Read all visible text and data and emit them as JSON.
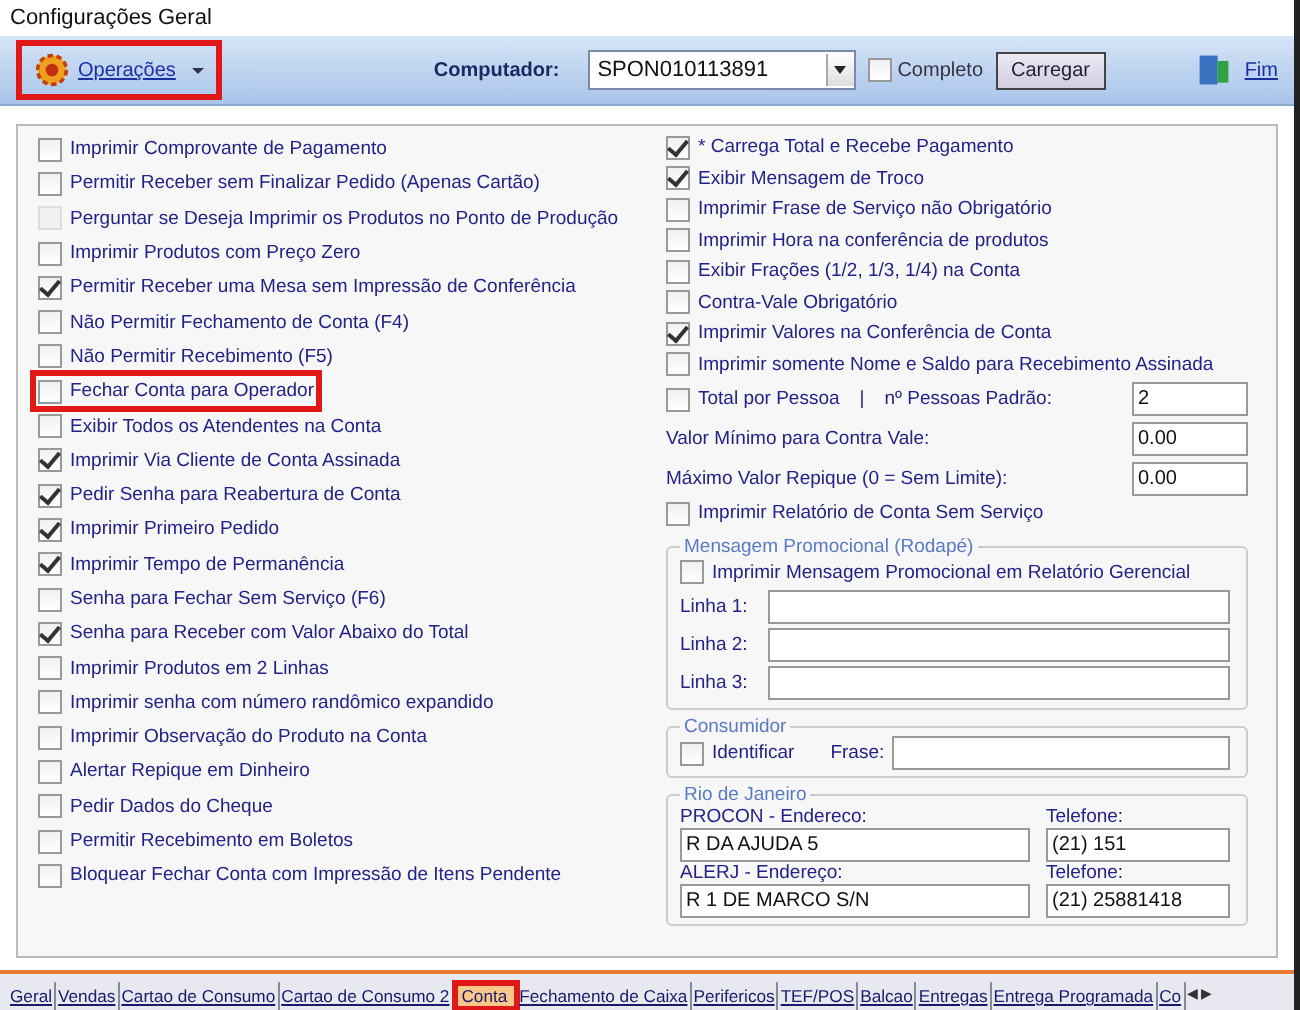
{
  "window": {
    "title": "Configurações Geral"
  },
  "toolbar": {
    "menu": {
      "label": "Operações",
      "highlighted": true
    },
    "computer_label": "Computador:",
    "computer_value": "SPON010113891",
    "complete": {
      "label": "Completo",
      "checked": false
    },
    "load_button": "Carregar",
    "exit_button": "Fim"
  },
  "left_options": [
    {
      "label": "Imprimir Comprovante de Pagamento",
      "checked": false,
      "disabled": false,
      "highlighted": false
    },
    {
      "label": "Permitir Receber sem Finalizar Pedido (Apenas Cartão)",
      "checked": false,
      "disabled": false,
      "highlighted": false
    },
    {
      "label": "Perguntar se Deseja Imprimir os Produtos no Ponto de Produção",
      "checked": false,
      "disabled": true,
      "highlighted": false
    },
    {
      "label": "Imprimir Produtos com Preço Zero",
      "checked": false,
      "disabled": false,
      "highlighted": false
    },
    {
      "label": "Permitir Receber uma Mesa sem Impressão de Conferência",
      "checked": true,
      "disabled": false,
      "highlighted": false
    },
    {
      "label": "Não Permitir Fechamento de Conta (F4)",
      "checked": false,
      "disabled": false,
      "highlighted": false
    },
    {
      "label": "Não Permitir Recebimento (F5)",
      "checked": false,
      "disabled": false,
      "highlighted": false
    },
    {
      "label": "Fechar Conta para Operador",
      "checked": false,
      "disabled": false,
      "highlighted": true
    },
    {
      "label": "Exibir Todos os Atendentes na Conta",
      "checked": false,
      "disabled": false,
      "highlighted": false
    },
    {
      "label": "Imprimir Via Cliente de Conta Assinada",
      "checked": true,
      "disabled": false,
      "highlighted": false
    },
    {
      "label": "Pedir Senha para Reabertura de Conta",
      "checked": true,
      "disabled": false,
      "highlighted": false
    },
    {
      "label": "Imprimir Primeiro Pedido",
      "checked": true,
      "disabled": false,
      "highlighted": false
    },
    {
      "label": "Imprimir Tempo de Permanência",
      "checked": true,
      "disabled": false,
      "highlighted": false
    },
    {
      "label": "Senha para Fechar Sem Serviço (F6)",
      "checked": false,
      "disabled": false,
      "highlighted": false
    },
    {
      "label": "Senha para Receber com Valor Abaixo do Total",
      "checked": true,
      "disabled": false,
      "highlighted": false
    },
    {
      "label": "Imprimir Produtos em 2 Linhas",
      "checked": false,
      "disabled": false,
      "highlighted": false
    },
    {
      "label": "Imprimir senha com número randômico expandido",
      "checked": false,
      "disabled": false,
      "highlighted": false
    },
    {
      "label": "Imprimir Observação do Produto na Conta",
      "checked": false,
      "disabled": false,
      "highlighted": false
    },
    {
      "label": "Alertar Repique em Dinheiro",
      "checked": false,
      "disabled": false,
      "highlighted": false
    },
    {
      "label": "Pedir Dados do Cheque",
      "checked": false,
      "disabled": false,
      "highlighted": false
    },
    {
      "label": "Permitir Recebimento em Boletos",
      "checked": false,
      "disabled": false,
      "highlighted": false
    },
    {
      "label": "Bloquear Fechar Conta com Impressão de Itens Pendente",
      "checked": false,
      "disabled": false,
      "highlighted": false
    }
  ],
  "right_options": [
    {
      "label": "* Carrega Total e Recebe Pagamento",
      "checked": true
    },
    {
      "label": "Exibir Mensagem de Troco",
      "checked": true
    },
    {
      "label": "Imprimir Frase de Serviço não Obrigatório",
      "checked": false
    },
    {
      "label": "Imprimir Hora na conferência de produtos",
      "checked": false
    },
    {
      "label": "Exibir Frações (1/2, 1/3, 1/4) na Conta",
      "checked": false
    },
    {
      "label": "Contra-Vale Obrigatório",
      "checked": false
    },
    {
      "label": "Imprimir Valores na Conferência de Conta",
      "checked": true
    },
    {
      "label": "Imprimir somente Nome e Saldo para Recebimento Assinada",
      "checked": false
    }
  ],
  "per_person": {
    "label": "Total por Pessoa",
    "checked": false,
    "separator": "|",
    "people_label": "nº Pessoas Padrão:",
    "people_value": "2"
  },
  "value_fields": [
    {
      "label": "Valor Mínimo para Contra Vale:",
      "value": "0.00"
    },
    {
      "label": "Máximo Valor Repique (0 = Sem Limite):",
      "value": "0.00"
    }
  ],
  "report_option": {
    "label": "Imprimir Relatório de Conta Sem Serviço",
    "checked": false
  },
  "promo": {
    "title": "Mensagem Promocional (Rodapé)",
    "option": {
      "label": "Imprimir Mensagem Promocional em Relatório Gerencial",
      "checked": false
    },
    "lines": [
      {
        "label": "Linha 1:"
      },
      {
        "label": "Linha 2:"
      },
      {
        "label": "Linha 3:"
      }
    ]
  },
  "consumer": {
    "title": "Consumidor",
    "identify": {
      "label": "Identificar",
      "checked": false
    },
    "phrase_label": "Frase:"
  },
  "rio": {
    "title": "Rio de Janeiro",
    "rows": [
      {
        "address_label": "PROCON - Endereco:",
        "address": "R DA AJUDA 5",
        "phone_label": "Telefone:",
        "phone": "(21) 151"
      },
      {
        "address_label": "ALERJ - Endereço:",
        "address": "R 1 DE MARCO S/N",
        "phone_label": "Telefone:",
        "phone": "(21) 25881418"
      }
    ]
  },
  "tabs": [
    {
      "label": "Geral",
      "selected": false,
      "highlighted": false
    },
    {
      "label": "Vendas",
      "selected": false,
      "highlighted": false
    },
    {
      "label": "Cartao de Consumo",
      "selected": false,
      "highlighted": false
    },
    {
      "label": "Cartao de Consumo 2",
      "selected": false,
      "highlighted": false
    },
    {
      "label": "Conta",
      "selected": true,
      "highlighted": true
    },
    {
      "label": "Fechamento de Caixa",
      "selected": false,
      "highlighted": false
    },
    {
      "label": "Perifericos",
      "selected": false,
      "highlighted": false
    },
    {
      "label": "TEF/POS",
      "selected": false,
      "highlighted": false
    },
    {
      "label": "Balcao",
      "selected": false,
      "highlighted": false
    },
    {
      "label": "Entregas",
      "selected": false,
      "highlighted": false
    },
    {
      "label": "Entrega Programada",
      "selected": false,
      "highlighted": false
    },
    {
      "label": "Co",
      "selected": false,
      "highlighted": false
    }
  ],
  "tab_scroll": [
    "◀",
    "▶"
  ]
}
